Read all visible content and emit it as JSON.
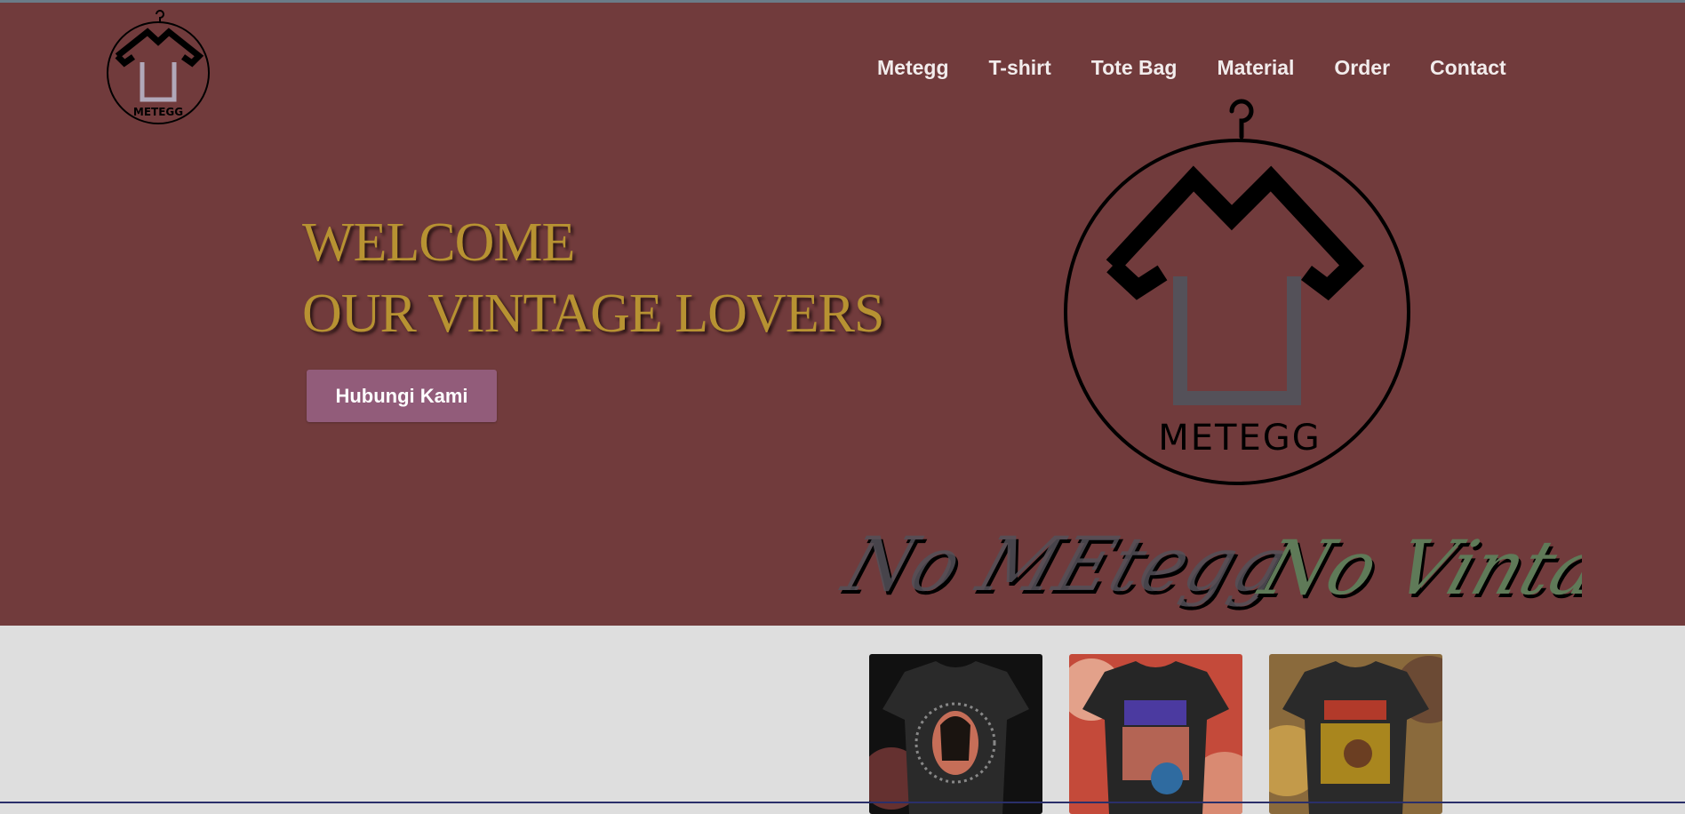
{
  "brand": {
    "logo_icon": "hanger-shirt-logo-icon",
    "logo_text": "METEGG"
  },
  "nav": {
    "items": [
      {
        "label": "Metegg"
      },
      {
        "label": "T-shirt"
      },
      {
        "label": "Tote Bag"
      },
      {
        "label": "Material"
      },
      {
        "label": "Order"
      },
      {
        "label": "Contact"
      }
    ]
  },
  "hero": {
    "title_line1": "WELCOME",
    "title_line2": "OUR VINTAGE LOVERS",
    "cta_label": "Hubungi Kami",
    "slogan_part1": "No MEtegg",
    "slogan_part2": "No Vintage"
  },
  "products": {
    "items": [
      {
        "name": "vintage-tee-1-thumbnail",
        "icon": "tshirt-image"
      },
      {
        "name": "vintage-tee-2-thumbnail",
        "icon": "tshirt-image"
      },
      {
        "name": "vintage-tee-3-thumbnail",
        "icon": "tshirt-image"
      }
    ]
  },
  "colors": {
    "hero_bg": "#713b3c",
    "page_bg": "#dedede",
    "title_gold": "#b79232",
    "cta_bg": "#925c7a",
    "logo_gray": "#545159",
    "slogan_green": "#5f7a58"
  }
}
